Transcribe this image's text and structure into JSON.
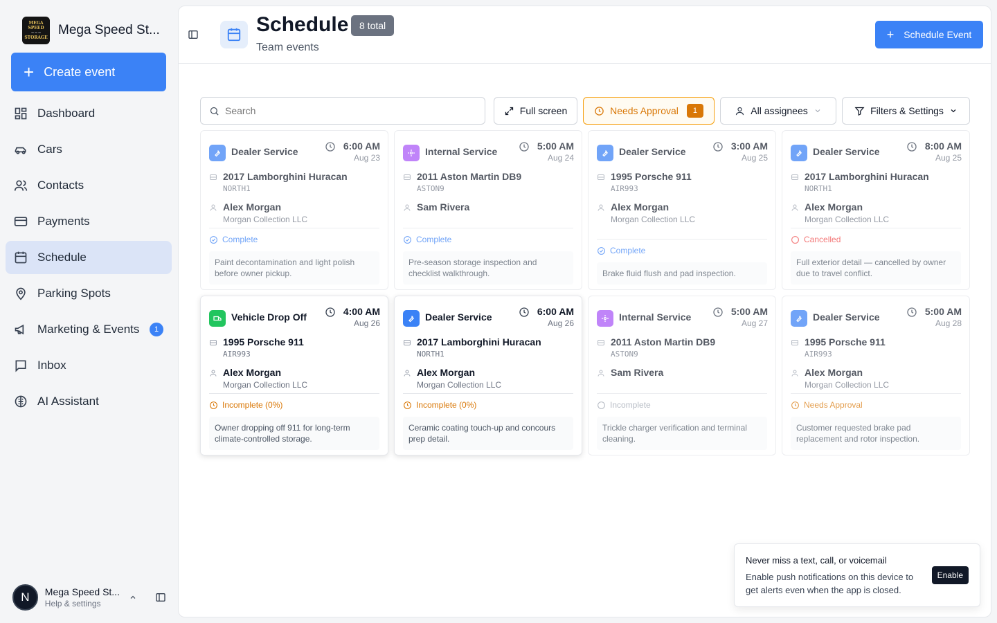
{
  "brand": {
    "name": "Mega Speed St...",
    "logo_text": "MEGA SPEED STORAGE"
  },
  "sidebar": {
    "create_label": "Create event",
    "items": [
      {
        "label": "Dashboard",
        "icon": "dashboard-icon"
      },
      {
        "label": "Cars",
        "icon": "car-icon"
      },
      {
        "label": "Contacts",
        "icon": "contacts-icon"
      },
      {
        "label": "Payments",
        "icon": "credit-card-icon"
      },
      {
        "label": "Schedule",
        "icon": "calendar-icon",
        "active": true
      },
      {
        "label": "Parking Spots",
        "icon": "map-pin-icon"
      },
      {
        "label": "Marketing & Events",
        "icon": "megaphone-icon",
        "badge": "1"
      },
      {
        "label": "Inbox",
        "icon": "inbox-icon"
      },
      {
        "label": "AI Assistant",
        "icon": "brain-icon"
      }
    ]
  },
  "user": {
    "initial": "N",
    "name": "Mega Speed St...",
    "sub": "Help & settings"
  },
  "header": {
    "title": "Schedule",
    "badge": "8 total",
    "subtitle": "Team events",
    "action_label": "Schedule Event"
  },
  "toolbar": {
    "search_placeholder": "Search",
    "fullscreen_label": "Full screen",
    "approval_label": "Needs Approval",
    "approval_count": "1",
    "assignees_label": "All assignees",
    "filters_label": "Filters & Settings"
  },
  "colors": {
    "accent": "#3b82f6",
    "dealer": "#3b82f6",
    "internal": "#a855f7",
    "dropoff": "#22c55e",
    "complete": "#3b82f6",
    "cancelled": "#ef4444",
    "warning": "#d97706",
    "neutral": "#9ca3af"
  },
  "events": [
    {
      "type": "Dealer Service",
      "time": "6:00 AM",
      "date": "Aug 23",
      "car": "2017 Lamborghini Huracan",
      "plate": "NORTH1",
      "person": "Alex Morgan",
      "company": "Morgan Collection LLC",
      "status": "Complete",
      "status_kind": "complete",
      "note": "Paint decontamination and light polish before owner pickup.",
      "type_kind": "dealer"
    },
    {
      "type": "Internal Service",
      "time": "5:00 AM",
      "date": "Aug 24",
      "car": "2011 Aston Martin DB9",
      "plate": "ASTON9",
      "person": "Sam Rivera",
      "company": "",
      "status": "Complete",
      "status_kind": "complete",
      "note": "Pre-season storage inspection and checklist walkthrough.",
      "type_kind": "internal"
    },
    {
      "type": "Dealer Service",
      "time": "3:00 AM",
      "date": "Aug 25",
      "car": "1995 Porsche 911",
      "plate": "AIR993",
      "person": "Alex Morgan",
      "company": "Morgan Collection LLC",
      "status": "Complete",
      "status_kind": "complete",
      "note": "Brake fluid flush and pad inspection.",
      "type_kind": "dealer"
    },
    {
      "type": "Dealer Service",
      "time": "8:00 AM",
      "date": "Aug 25",
      "car": "2017 Lamborghini Huracan",
      "plate": "NORTH1",
      "person": "Alex Morgan",
      "company": "Morgan Collection LLC",
      "status": "Cancelled",
      "status_kind": "cancelled",
      "note": "Full exterior detail — cancelled by owner due to travel conflict.",
      "type_kind": "dealer"
    },
    {
      "type": "Vehicle Drop Off",
      "time": "4:00 AM",
      "date": "Aug 26",
      "car": "1995 Porsche 911",
      "plate": "AIR993",
      "person": "Alex Morgan",
      "company": "Morgan Collection LLC",
      "status": "Incomplete (0%)",
      "status_kind": "warning",
      "note": "Owner dropping off 911 for long-term climate-controlled storage.",
      "type_kind": "dropoff"
    },
    {
      "type": "Dealer Service",
      "time": "6:00 AM",
      "date": "Aug 26",
      "car": "2017 Lamborghini Huracan",
      "plate": "NORTH1",
      "person": "Alex Morgan",
      "company": "Morgan Collection LLC",
      "status": "Incomplete (0%)",
      "status_kind": "warning",
      "note": "Ceramic coating touch-up and concours prep detail.",
      "type_kind": "dealer"
    },
    {
      "type": "Internal Service",
      "time": "5:00 AM",
      "date": "Aug 27",
      "car": "2011 Aston Martin DB9",
      "plate": "ASTON9",
      "person": "Sam Rivera",
      "company": "",
      "status": "Incomplete",
      "status_kind": "neutral",
      "note": "Trickle charger verification and terminal cleaning.",
      "type_kind": "internal"
    },
    {
      "type": "Dealer Service",
      "time": "5:00 AM",
      "date": "Aug 28",
      "car": "1995 Porsche 911",
      "plate": "AIR993",
      "person": "Alex Morgan",
      "company": "Morgan Collection LLC",
      "status": "Needs Approval",
      "status_kind": "warning",
      "note": "Customer requested brake pad replacement and rotor inspection.",
      "type_kind": "dealer"
    }
  ],
  "toast": {
    "title": "Never miss a text, call, or voicemail",
    "body": "Enable push notifications on this device to get alerts even when the app is closed.",
    "button": "Enable"
  }
}
